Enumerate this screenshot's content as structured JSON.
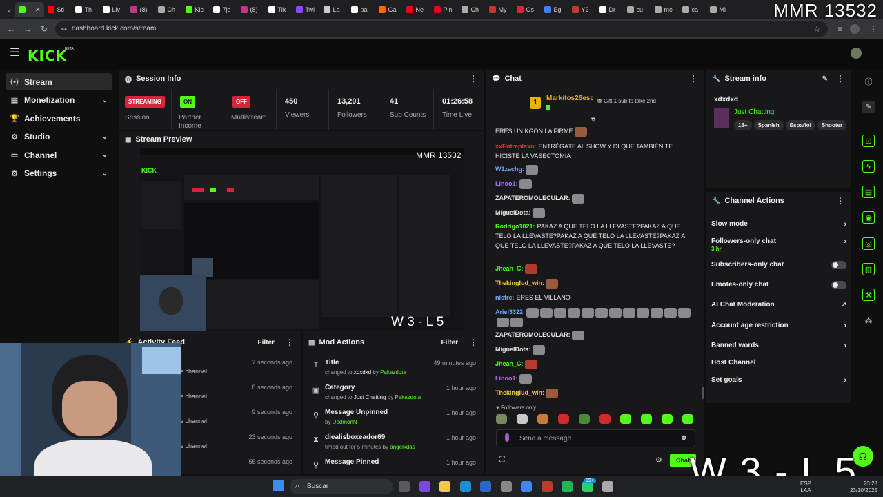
{
  "browser": {
    "tabs": [
      "",
      "Sti",
      "Th",
      "Liv",
      "(8)",
      "Ch",
      "Kic",
      "7je",
      "(8)",
      "Tik",
      "Twi",
      "La",
      "pal",
      "Ga",
      "Ne",
      "Pin",
      "Ch",
      "My",
      "Os",
      "Eg",
      "Y2",
      "Dr",
      "cu",
      "me",
      "ca",
      "Mi"
    ],
    "url": "dashboard.kick.com/stream"
  },
  "overlay": {
    "mmr": "MMR 13532",
    "wl": "W 3 - L 5",
    "preview_mmr": "MMR 13532",
    "preview_wl": "W 3 - L 5"
  },
  "brand": {
    "logo": "KICK",
    "beta": "BETA",
    "accent": "#53fc18"
  },
  "sidebar": {
    "items": [
      {
        "icon": "stream-icon",
        "label": "Stream",
        "active": true
      },
      {
        "icon": "monetization-icon",
        "label": "Monetization",
        "chevron": true
      },
      {
        "icon": "trophy-icon",
        "label": "Achievements"
      },
      {
        "icon": "studio-icon",
        "label": "Studio",
        "chevron": true
      },
      {
        "icon": "channel-icon",
        "label": "Channel",
        "chevron": true
      },
      {
        "icon": "gear-icon",
        "label": "Settings",
        "chevron": true
      }
    ]
  },
  "session": {
    "title": "Session Info",
    "streaming_badge": "STREAMING",
    "streaming_label": "Session",
    "partner_badge": "ON",
    "partner_label": "Partner Income",
    "multistream_badge": "OFF",
    "multistream_label": "Multistream",
    "viewers": "450",
    "viewers_label": "Viewers",
    "followers": "13,201",
    "followers_label": "Followers",
    "subs": "41",
    "subs_label": "Sub Counts",
    "time": "01:26:58",
    "time_label": "Time Live"
  },
  "preview": {
    "title": "Stream Preview"
  },
  "activity": {
    "title": "Activity Feed",
    "filter": "Filter",
    "rows": [
      {
        "text": "e channel",
        "time": "7 seconds ago"
      },
      {
        "text": "e channel",
        "time": "8 seconds ago"
      },
      {
        "text": "e channel",
        "time": "9 seconds ago"
      },
      {
        "text": "e channel",
        "time": "23 seconds ago"
      },
      {
        "text": "",
        "time": "55 seconds ago"
      }
    ]
  },
  "mod": {
    "title": "Mod Actions",
    "filter": "Filter",
    "rows": [
      {
        "icon": "text-icon",
        "title": "Title",
        "pre": "changed to ",
        "a": "xdxdxd",
        "mid": " by ",
        "b": "Pakazdota",
        "post": "",
        "time": "49 minutes ago"
      },
      {
        "icon": "category-icon",
        "title": "Category",
        "pre": "changed to ",
        "a": "Just Chatting",
        "mid": " by ",
        "b": "Pakazdota",
        "post": "",
        "time": "1 hour ago"
      },
      {
        "icon": "pin-icon",
        "title": "Message Unpinned",
        "pre": "by ",
        "a": "",
        "mid": "",
        "b": "DedmonN",
        "post": "",
        "time": "1 hour ago"
      },
      {
        "icon": "hourglass-icon",
        "title": "diealisboxeador69",
        "pre": "timed out for 5 minutes by ",
        "a": "",
        "mid": "",
        "b": "angelxdas",
        "post": "",
        "time": "1 hour ago"
      },
      {
        "icon": "pin-icon",
        "title": "Message Pinned",
        "pre": "",
        "a": "",
        "mid": "",
        "b": "",
        "post": "",
        "time": "1 hour ago"
      }
    ]
  },
  "chat": {
    "title": "Chat",
    "pinned_user": "Markitos26esc",
    "pinned_rank": "1",
    "gift_text": "Gift 1 sub to take 2nd",
    "messages": [
      {
        "user": "",
        "color": "#e6e6e6",
        "text": "ERES UN KGON LA FIRME"
      },
      {
        "user": "xxEntreplaxo:",
        "color": "#d23b3b",
        "text": "ENTRÉGATE AL SHOW Y DI QUE TAMBIÉN TE HICISTE LA VASECTOMÍA"
      },
      {
        "user": "W1zachg:",
        "color": "#6aa8ff",
        "text": ""
      },
      {
        "user": "Linoo1:",
        "color": "#b36bff",
        "text": ""
      },
      {
        "user": "ZAPATEROMOLECULAR:",
        "color": "#e6e6e6",
        "text": ""
      },
      {
        "user": "MiguelDota:",
        "color": "#e6e6e6",
        "text": ""
      },
      {
        "user": "Rodrigo1021:",
        "color": "#53fc18",
        "text": "PAKAZ A QUE TELO LA LLEVASTE?PAKAZ A QUE TELO LA LLEVASTE?PAKAZ A QUE TELO LA LLEVASTE?PAKAZ A QUE TELO LA LLEVASTE?PAKAZ A QUE TELO LA LLEVASTE?"
      },
      {
        "user": "Jhean_C:",
        "color": "#53fc18",
        "text": ""
      },
      {
        "user": "Thekinglud_win:",
        "color": "#f2c94c",
        "text": ""
      },
      {
        "user": "nictrc:",
        "color": "#6aa8ff",
        "text": "ERES EL VILLANO"
      },
      {
        "user": "Ariel3322:",
        "color": "#6aa8ff",
        "text": ""
      },
      {
        "user": "ZAPATEROMOLECULAR:",
        "color": "#e6e6e6",
        "text": ""
      },
      {
        "user": "MiguelDota:",
        "color": "#e6e6e6",
        "text": ""
      },
      {
        "user": "Jhean_C:",
        "color": "#53fc18",
        "text": ""
      },
      {
        "user": "Linoo1:",
        "color": "#b36bff",
        "text": ""
      },
      {
        "user": "Thekinglud_win:",
        "color": "#f2c94c",
        "text": ""
      }
    ],
    "followers_only": "Followers only",
    "placeholder": "Send a message",
    "send": "Chat"
  },
  "stream_info": {
    "title": "Stream info",
    "stream_title": "xdxdxd",
    "category": "Just Chatting",
    "tags": [
      "18+",
      "Spanish",
      "Español",
      "Shooter"
    ]
  },
  "channel_actions": {
    "title": "Channel Actions",
    "items": [
      {
        "label": "Slow mode",
        "control": "arrow",
        "sub": ""
      },
      {
        "label": "Followers-only chat",
        "control": "arrow",
        "sub": "3 hr"
      },
      {
        "label": "Subscribers-only chat",
        "control": "toggle",
        "sub": ""
      },
      {
        "label": "Emotes-only chat",
        "control": "toggle",
        "sub": ""
      },
      {
        "label": "AI Chat Moderation",
        "control": "external",
        "sub": ""
      },
      {
        "label": "Account age restriction",
        "control": "arrow",
        "sub": ""
      },
      {
        "label": "Banned words",
        "control": "arrow",
        "sub": ""
      },
      {
        "label": "Host Channel",
        "control": "none",
        "sub": ""
      },
      {
        "label": "Set goals",
        "control": "arrow",
        "sub": ""
      }
    ]
  },
  "taskbar": {
    "search": "Buscar",
    "lang": "ESP",
    "lang2": "LAA",
    "time": "23:28",
    "date": "23/10/2025",
    "badge": "99+"
  }
}
